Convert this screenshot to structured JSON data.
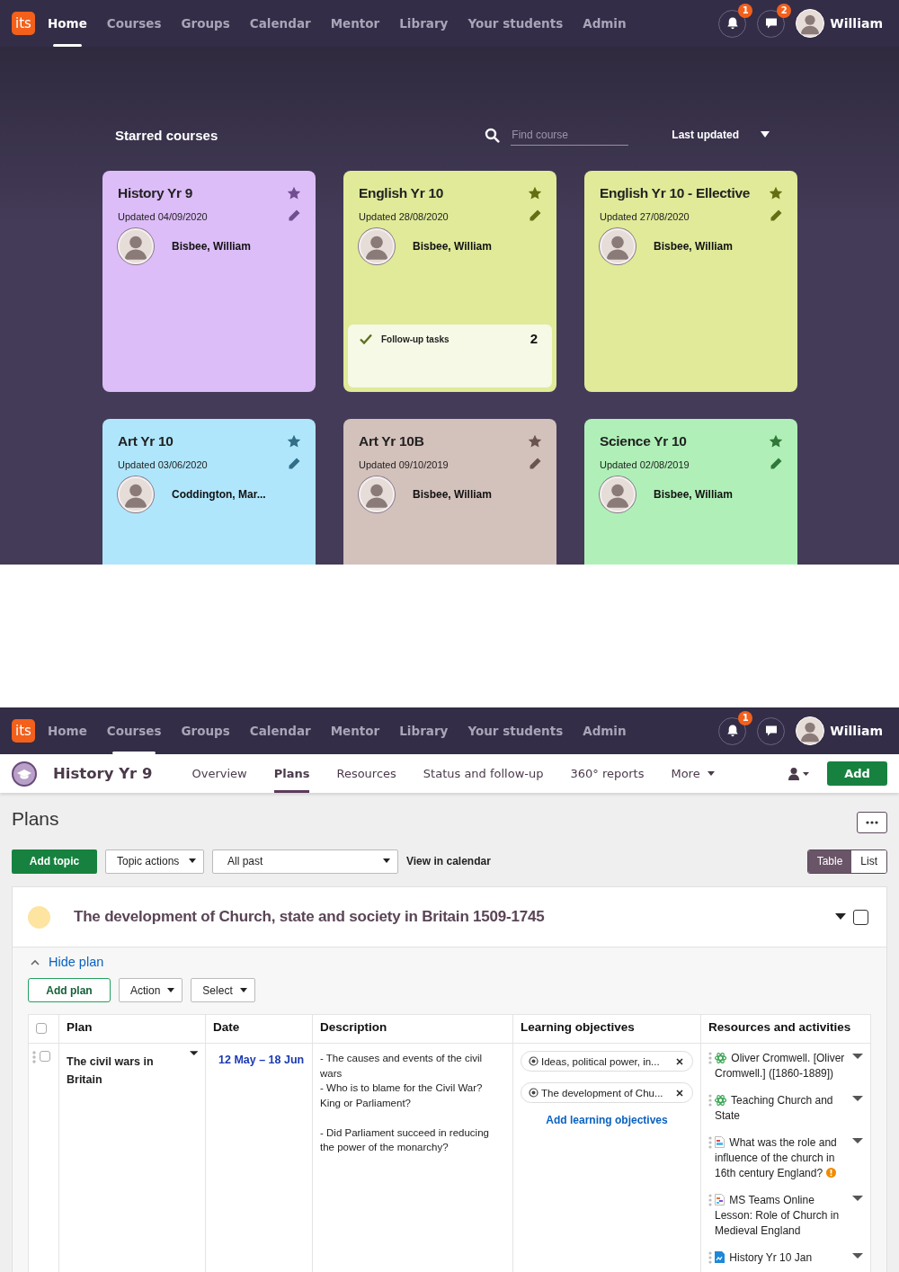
{
  "screen_1": {
    "nav": {
      "logo": "its",
      "items": [
        {
          "label": "Home",
          "selected": true
        },
        {
          "label": "Courses",
          "selected": false
        },
        {
          "label": "Groups",
          "selected": false
        },
        {
          "label": "Calendar",
          "selected": false
        },
        {
          "label": "Mentor",
          "selected": false
        },
        {
          "label": "Library",
          "selected": false
        },
        {
          "label": "Your students",
          "selected": false
        },
        {
          "label": "Admin",
          "selected": false
        }
      ],
      "notification_badge": "1",
      "message_badge": "2",
      "user": "William"
    },
    "starred": {
      "title": "Starred courses",
      "search": {
        "placeholder": "Find course"
      },
      "sort": "Last updated",
      "courses": [
        {
          "title": "History Yr 9",
          "updated": "Updated 04/09/2020",
          "teacher": "Bisbee, William",
          "color": "#dcbdf8"
        },
        {
          "title": "English Yr 10",
          "updated": "Updated 28/08/2020",
          "teacher": "Bisbee, William",
          "color": "#e0ea98",
          "followup": {
            "label": "Follow-up tasks",
            "count": "2"
          }
        },
        {
          "title": "English Yr 10 - Ellective",
          "updated": "Updated 27/08/2020",
          "teacher": "Bisbee, William",
          "color": "#e0ea98"
        },
        {
          "title": "Art Yr 10",
          "updated": "Updated 03/06/2020",
          "teacher": "Coddington, Mar...",
          "color": "#b0e6fc"
        },
        {
          "title": "Art Yr 10B",
          "updated": "Updated 09/10/2019",
          "teacher": "Bisbee, William",
          "color": "#d3c1bb"
        },
        {
          "title": "Science Yr 10",
          "updated": "Updated 02/08/2019",
          "teacher": "Bisbee, William",
          "color": "#b0f0b8"
        }
      ]
    }
  },
  "screen_2": {
    "nav": {
      "logo": "its",
      "items": [
        {
          "label": "Home",
          "selected": false
        },
        {
          "label": "Courses",
          "selected": true
        },
        {
          "label": "Groups",
          "selected": false
        },
        {
          "label": "Calendar",
          "selected": false
        },
        {
          "label": "Mentor",
          "selected": false
        },
        {
          "label": "Library",
          "selected": false
        },
        {
          "label": "Your students",
          "selected": false
        },
        {
          "label": "Admin",
          "selected": false
        }
      ],
      "notification_badge": "1",
      "user": "William"
    },
    "course": {
      "title": "History Yr 9",
      "tabs": [
        {
          "label": "Overview",
          "selected": false
        },
        {
          "label": "Plans",
          "selected": true
        },
        {
          "label": "Resources",
          "selected": false
        },
        {
          "label": "Status and follow-up",
          "selected": false
        },
        {
          "label": "360° reports",
          "selected": false
        },
        {
          "label": "More",
          "selected": false
        }
      ],
      "add_button": "Add"
    },
    "page_title": "Plans",
    "toolbar": {
      "add_topic": "Add topic",
      "topic_actions": "Topic actions",
      "filter": "All past",
      "calendar_link": "View in calendar",
      "views": [
        {
          "label": "Table",
          "selected": true
        },
        {
          "label": "List",
          "selected": false
        }
      ]
    },
    "topic": {
      "title": "The development of Church, state and society in Britain 1509-1745",
      "color": "#fde4a0",
      "checked": false,
      "hide_link": "Hide plan",
      "add_plan": "Add plan",
      "action": "Action",
      "select": "Select",
      "table": {
        "select_all_checked": false,
        "columns": [
          "Plan",
          "Date",
          "Description",
          "Learning objectives",
          "Resources and activities"
        ],
        "rows": [
          {
            "checked": false,
            "plan": "The civil wars in Britain",
            "date": "12 May – 18 Jun",
            "description": "- The causes and events of the civil wars\n- Who is to blame for the Civil War? King or Parliament?\n\n- Did Parliament succeed in reducing the power of the monarchy?",
            "objectives": [
              "Ideas, political power, in...",
              "The development of Chu..."
            ],
            "add_objectives": "Add learning objectives",
            "resources": [
              {
                "kind": "web",
                "title": "Oliver Cromwell. [Oliver Cromwell.] ([1860-1889])",
                "warning": false
              },
              {
                "kind": "web",
                "title": "Teaching Church and State",
                "warning": false
              },
              {
                "kind": "document",
                "title": "What was the role and influence of the church in 16th century England?",
                "warning": true
              },
              {
                "kind": "meeting",
                "title": "MS Teams Online Lesson: Role of Church in Medieval England",
                "warning": false
              },
              {
                "kind": "file",
                "title": "History Yr 10 Jan",
                "warning": false
              }
            ]
          }
        ]
      }
    }
  }
}
